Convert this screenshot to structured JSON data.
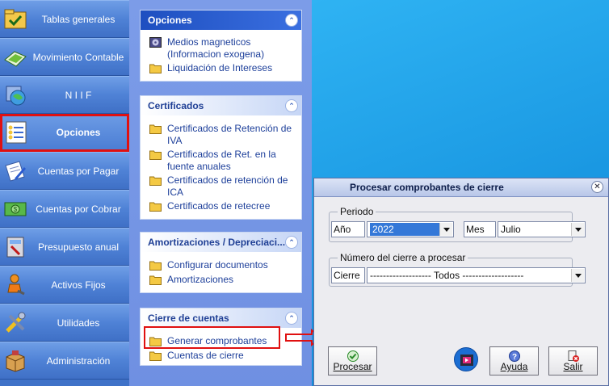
{
  "nav": {
    "items": [
      {
        "label": "Tablas generales"
      },
      {
        "label": "Movimiento Contable"
      },
      {
        "label": "N I I F"
      },
      {
        "label": "Opciones"
      },
      {
        "label": "Cuentas por Pagar"
      },
      {
        "label": "Cuentas por Cobrar"
      },
      {
        "label": "Presupuesto anual"
      },
      {
        "label": "Activos Fijos"
      },
      {
        "label": "Utilidades"
      },
      {
        "label": "Administración"
      }
    ],
    "active_index": 3
  },
  "pane": {
    "groups": [
      {
        "title": "Opciones",
        "tasks": [
          "Medios magneticos (Informacion exogena)",
          "Liquidación de Intereses"
        ]
      },
      {
        "title": "Certificados",
        "tasks": [
          "Certificados de Retención de IVA",
          "Certificados de Ret. en la fuente anuales",
          "Certificados de retención de ICA",
          "Certificados de retecree"
        ]
      },
      {
        "title": "Amortizaciones / Depreciaci...",
        "tasks": [
          "Configurar documentos",
          "Amortizaciones"
        ]
      },
      {
        "title": "Cierre de cuentas",
        "tasks": [
          "Generar comprobantes",
          "Cuentas de cierre"
        ]
      }
    ]
  },
  "dialog": {
    "title": "Procesar comprobantes de cierre",
    "periodo": {
      "legend": "Periodo",
      "anio_label": "Año",
      "anio_value": "2022",
      "mes_label": "Mes",
      "mes_value": "Julio"
    },
    "cierre": {
      "legend": "Número del cierre a procesar",
      "label": "Cierre",
      "value": "------------------- Todos -------------------"
    },
    "buttons": {
      "procesar": "Procesar",
      "ayuda": "Ayuda",
      "salir": "Salir"
    }
  },
  "colors": {
    "highlight": "#e01010",
    "nav_blue": "#4f82d6",
    "link_blue": "#1d3f9a"
  }
}
